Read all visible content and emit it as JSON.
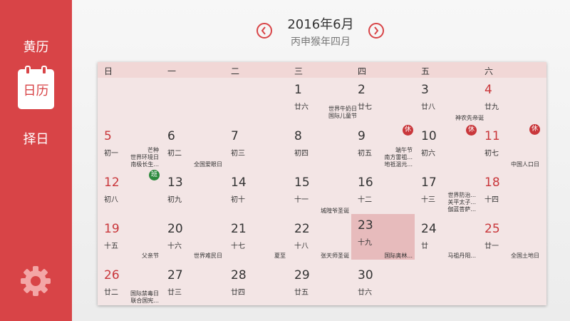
{
  "sidebar": {
    "items": [
      {
        "label": "黄历"
      },
      {
        "label": "日历"
      },
      {
        "label": "择日"
      }
    ],
    "settings_icon": "gear-icon"
  },
  "header": {
    "title": "2016年6月",
    "subtitle": "丙申猴年四月",
    "prev_icon": "chevron-left-icon",
    "next_icon": "chevron-right-icon"
  },
  "weekdays": [
    "日",
    "一",
    "二",
    "三",
    "四",
    "五",
    "六"
  ],
  "days": [
    {
      "num": "1",
      "lunar": "廿六",
      "festival": ""
    },
    {
      "num": "2",
      "lunar": "廿七",
      "festival": "世界牛奶日\n国际儿童节"
    },
    {
      "num": "3",
      "lunar": "廿八",
      "festival": ""
    },
    {
      "num": "4",
      "lunar": "廿九",
      "festival": "神农先帝诞"
    },
    {
      "num": "5",
      "lunar": "初一",
      "festival": ""
    },
    {
      "num": "6",
      "lunar": "初二",
      "festival": "芒种\n世界环境日\n南极长生..."
    },
    {
      "num": "7",
      "lunar": "初三",
      "festival": "全国爱眼日"
    },
    {
      "num": "8",
      "lunar": "初四",
      "festival": ""
    },
    {
      "num": "9",
      "lunar": "初五",
      "festival": ""
    },
    {
      "num": "10",
      "lunar": "初六",
      "festival": "端午节\n南方雷祖...\n地祇温元..."
    },
    {
      "num": "11",
      "lunar": "初七",
      "festival": ""
    },
    {
      "num": "12",
      "lunar": "初八",
      "festival": "中国人口日"
    },
    {
      "num": "13",
      "lunar": "初九",
      "festival": ""
    },
    {
      "num": "14",
      "lunar": "初十",
      "festival": ""
    },
    {
      "num": "15",
      "lunar": "十一",
      "festival": ""
    },
    {
      "num": "16",
      "lunar": "十二",
      "festival": "城隍爷圣诞"
    },
    {
      "num": "17",
      "lunar": "十三",
      "festival": ""
    },
    {
      "num": "18",
      "lunar": "十四",
      "festival": "世界防治...\n关平太子...\n伽蓝菩萨..."
    },
    {
      "num": "19",
      "lunar": "十五",
      "festival": ""
    },
    {
      "num": "20",
      "lunar": "十六",
      "festival": "父亲节"
    },
    {
      "num": "21",
      "lunar": "十七",
      "festival": "世界难民日"
    },
    {
      "num": "22",
      "lunar": "十八",
      "festival": "夏至"
    },
    {
      "num": "23",
      "lunar": "十九",
      "festival": "张天师圣诞"
    },
    {
      "num": "24",
      "lunar": "廿",
      "festival": "国际奥林..."
    },
    {
      "num": "25",
      "lunar": "廿一",
      "festival": "马祖丹阳..."
    },
    {
      "num": "26",
      "lunar": "廿二",
      "festival": "全国土地日"
    },
    {
      "num": "27",
      "lunar": "廿三",
      "festival": ""
    },
    {
      "num": "28",
      "lunar": "廿四",
      "festival": "国际禁毒日\n联合国宪..."
    },
    {
      "num": "29",
      "lunar": "廿五",
      "festival": ""
    },
    {
      "num": "30",
      "lunar": "廿六",
      "festival": ""
    }
  ],
  "badges": [
    {
      "text": "休",
      "type": "rest"
    },
    {
      "text": "休",
      "type": "rest"
    },
    {
      "text": "休",
      "type": "rest"
    },
    {
      "text": "班",
      "type": "work"
    }
  ],
  "today": "23",
  "colors": {
    "accent": "#d84447",
    "holiday_red": "#c9373b",
    "work_green": "#2d8a3e",
    "today_highlight": "#e7bbbc"
  }
}
